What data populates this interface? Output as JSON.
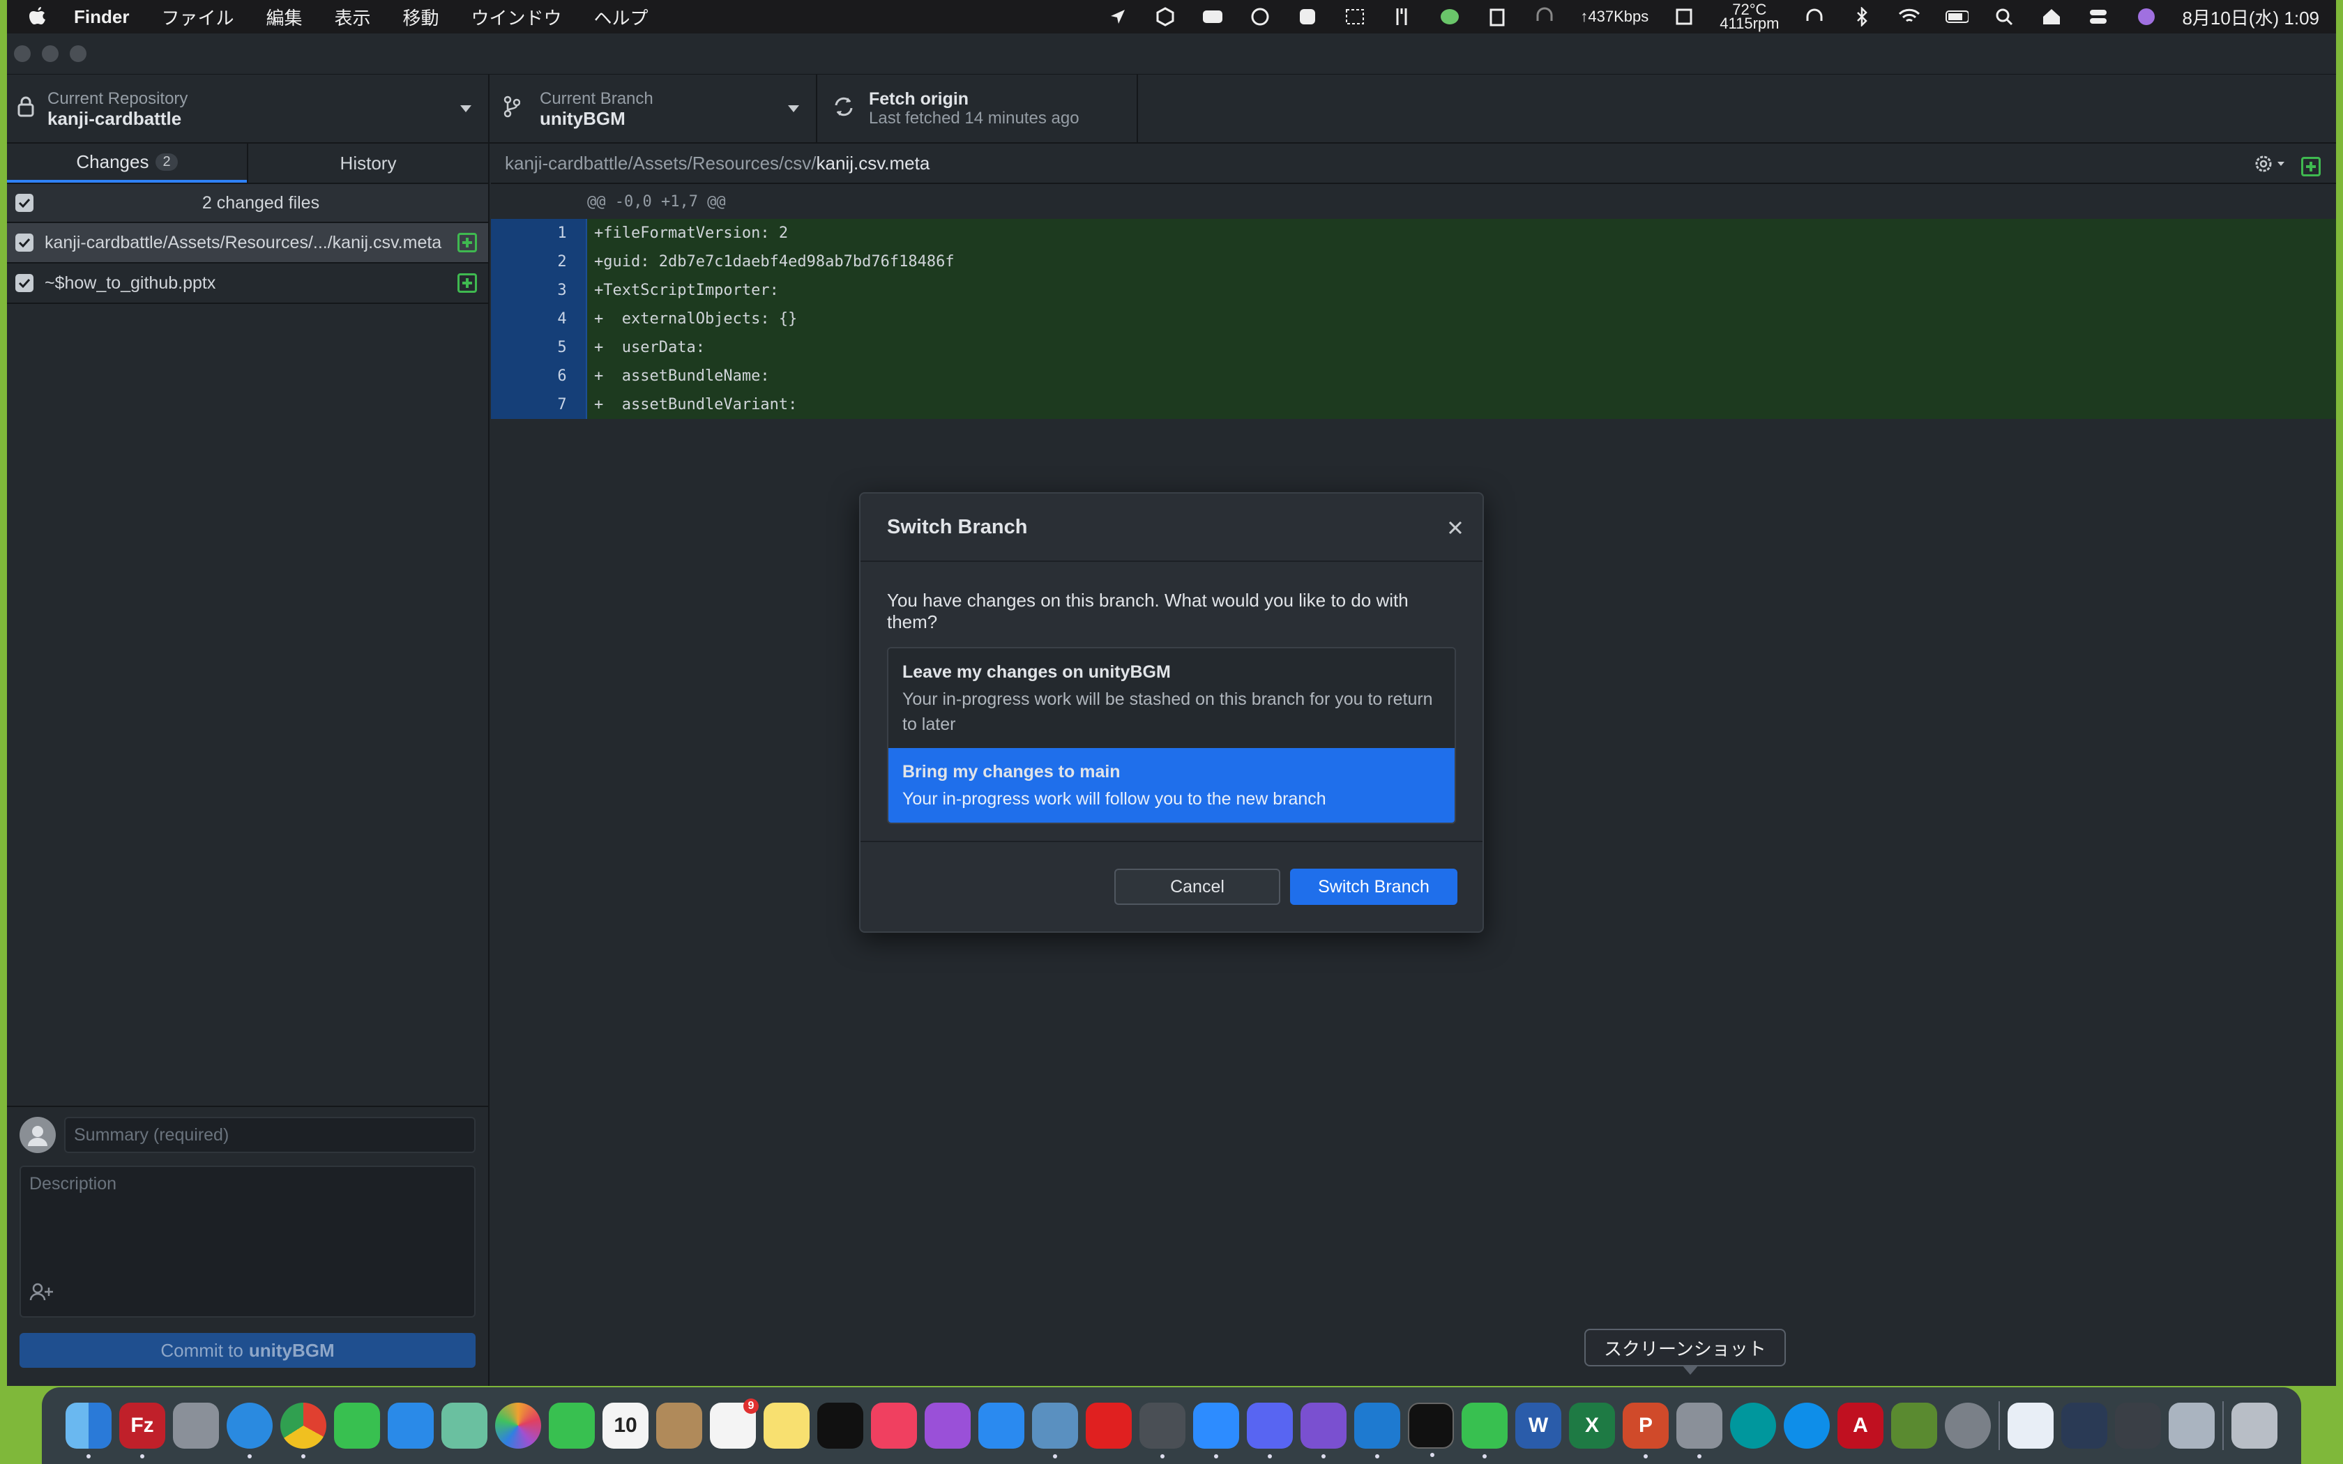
{
  "menubar": {
    "app_name": "Finder",
    "items": [
      "ファイル",
      "編集",
      "表示",
      "移動",
      "ウインドウ",
      "ヘルプ"
    ],
    "network_speed": "437Kbps",
    "temp": "72°C",
    "fan": "4115rpm",
    "clock": "8月10日(水)  1:09"
  },
  "toolbar": {
    "repo_title": "Current Repository",
    "repo_name": "kanji-cardbattle",
    "branch_title": "Current Branch",
    "branch_name": "unityBGM",
    "fetch_title": "Fetch origin",
    "fetch_sub": "Last fetched 14 minutes ago"
  },
  "sidebar": {
    "tab_changes": "Changes",
    "changes_count": "2",
    "tab_history": "History",
    "changed_files_label": "2 changed files",
    "files": [
      {
        "path": "kanji-cardbattle/Assets/Resources/.../kanij.csv.meta"
      },
      {
        "path": "~$how_to_github.pptx"
      }
    ]
  },
  "commit": {
    "summary_placeholder": "Summary (required)",
    "description_placeholder": "Description",
    "button_prefix": "Commit to",
    "button_branch": "unityBGM"
  },
  "diff": {
    "path_prefix": "kanji-cardbattle/Assets/Resources/csv/",
    "file_name": "kanij.csv.meta",
    "hunk": "@@ -0,0 +1,7 @@",
    "lines": [
      {
        "n": "1",
        "code": "+fileFormatVersion: 2"
      },
      {
        "n": "2",
        "code": "+guid: 2db7e7c1daebf4ed98ab7bd76f18486f"
      },
      {
        "n": "3",
        "code": "+TextScriptImporter:"
      },
      {
        "n": "4",
        "code": "+  externalObjects: {}"
      },
      {
        "n": "5",
        "code": "+  userData:"
      },
      {
        "n": "6",
        "code": "+  assetBundleName:"
      },
      {
        "n": "7",
        "code": "+  assetBundleVariant:"
      }
    ]
  },
  "dialog": {
    "title": "Switch Branch",
    "question": "You have changes on this branch. What would you like to do with them?",
    "option1_title": "Leave my changes on unityBGM",
    "option1_desc": "Your in-progress work will be stashed on this branch for you to return to later",
    "option2_title": "Bring my changes to main",
    "option2_desc": "Your in-progress work will follow you to the new branch",
    "cancel": "Cancel",
    "confirm": "Switch Branch"
  },
  "dock": {
    "tooltip": "スクリーンショット",
    "calendar_day": "10",
    "reminders_badge": "9",
    "apps": [
      "finder",
      "filezilla",
      "launchpad",
      "safari",
      "chrome",
      "messages",
      "mail",
      "maps",
      "photos",
      "facetime",
      "calendar",
      "contacts",
      "reminders",
      "notes",
      "appletv",
      "music",
      "podcasts",
      "appstore",
      "desktop-app",
      "acrobat",
      "unity",
      "zoom",
      "discord",
      "github-desktop",
      "vscode",
      "terminal",
      "line",
      "word",
      "excel",
      "powerpoint",
      "screenshot",
      "arduino",
      "teamviewer",
      "autocad",
      "minecraft",
      "system-preferences",
      "finder-file",
      "unity-hub",
      "unity-dark",
      "preview",
      "trash"
    ]
  },
  "colors": {
    "accent": "#1f6feb",
    "added_bg": "#1d3a1f",
    "added_gutter": "#153f78",
    "green": "#3fb950"
  }
}
